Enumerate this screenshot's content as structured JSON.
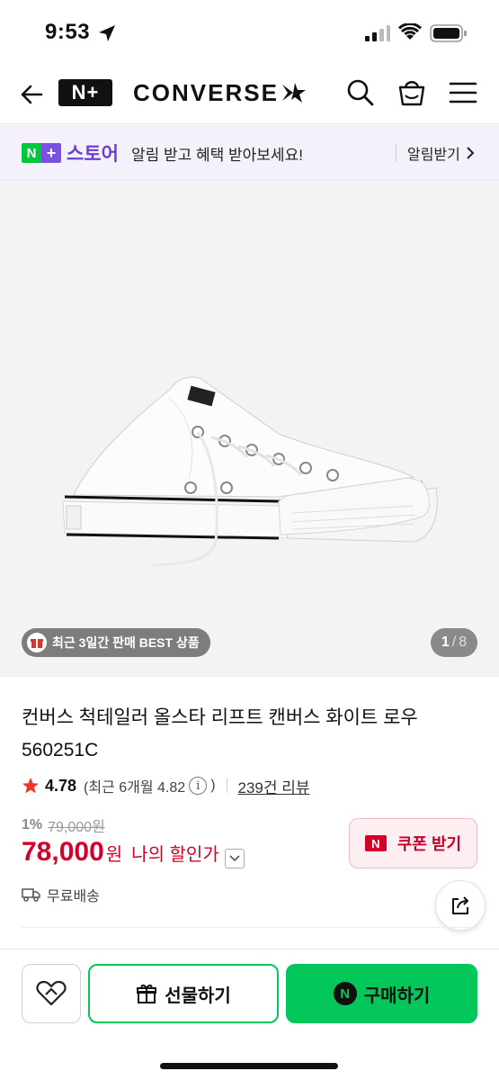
{
  "status_bar": {
    "time": "9:53"
  },
  "header": {
    "logo_text": "N+",
    "brand": "CONVERSE"
  },
  "promo": {
    "store_label": "스토어",
    "message": "알림 받고 혜택 받아보세요!",
    "cta": "알림받기"
  },
  "gallery": {
    "badge": "최근 3일간 판매 BEST 상품",
    "current_page": "1",
    "total_pages": "8"
  },
  "product": {
    "title": "컨버스 척테일러 올스타 리프트 캔버스 화이트 로우 560251C",
    "rating": "4.78",
    "rating_sub_prefix": "(최근 6개월 4.82",
    "rating_sub_suffix": ")",
    "reviews": "239건 리뷰",
    "discount_rate": "1%",
    "original_price": "79,000원",
    "sale_price": "78,000",
    "currency": "원",
    "my_price_label": "나의 할인가",
    "coupon_label": "쿠폰 받기",
    "shipping": "무료배송"
  },
  "actions": {
    "gift_label": "선물하기",
    "buy_label": "구매하기"
  },
  "colors": {
    "naver_green": "#03c75a",
    "price_red": "#d4002a",
    "store_purple": "#6b3fd4"
  }
}
